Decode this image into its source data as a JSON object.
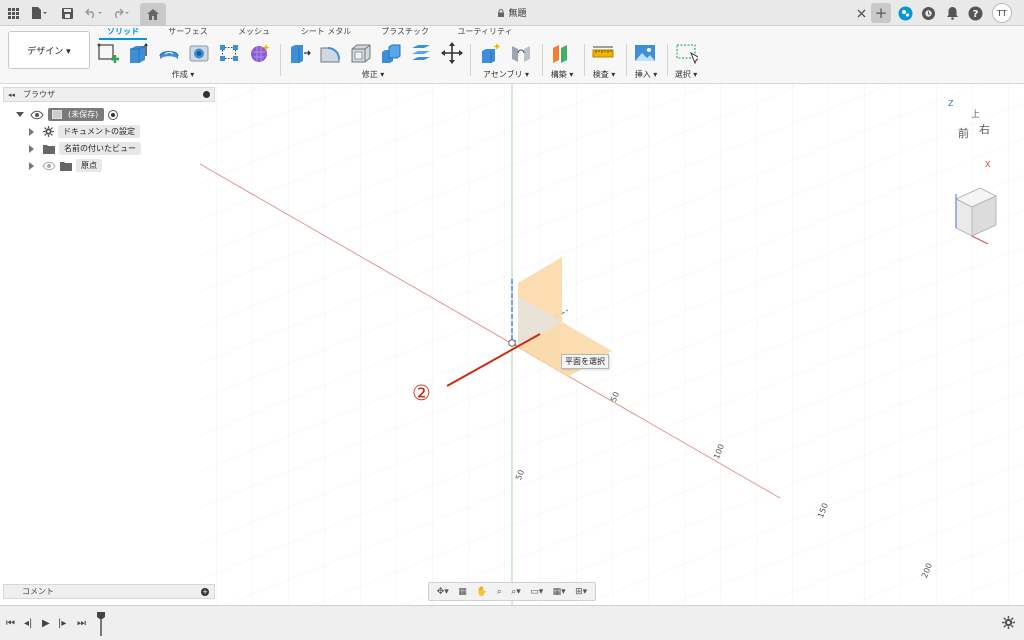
{
  "titlebar": {
    "document_title": "無題",
    "avatar_initials": "TT"
  },
  "toolbar": {
    "workspace_label": "デザイン ▾",
    "tabs": [
      {
        "label": "ソリッド",
        "active": true
      },
      {
        "label": "サーフェス",
        "active": false
      },
      {
        "label": "メッシュ",
        "active": false
      },
      {
        "label": "シート メタル",
        "active": false
      },
      {
        "label": "プラスチック",
        "active": false
      },
      {
        "label": "ユーティリティ",
        "active": false
      }
    ],
    "groups": {
      "create": "作成 ▾",
      "modify": "修正 ▾",
      "assemble": "アセンブリ ▾",
      "construct": "構築 ▾",
      "inspect": "検査 ▾",
      "insert": "挿入 ▾",
      "select": "選択 ▾"
    }
  },
  "browser": {
    "title": "ブラウザ",
    "root": "(未保存)",
    "items": [
      {
        "label": "ドキュメントの設定"
      },
      {
        "label": "名前の付いたビュー"
      },
      {
        "label": "原点"
      }
    ]
  },
  "comments": {
    "title": "コメント"
  },
  "viewport": {
    "tooltip": "平面を選択",
    "annotation_marker": "②",
    "tick_labels": [
      "50",
      "100",
      "150",
      "200",
      "50"
    ],
    "viewcube": {
      "top": "上",
      "front": "前",
      "right": "右",
      "axis_z": "Z",
      "axis_x": "X"
    }
  },
  "colors": {
    "accent": "#0696d7",
    "plane_fill": "#fcd9a8",
    "x_axis": "#e58a8a",
    "y_axis": "#7ccf7c",
    "z_axis": "#5a8be0",
    "annotation": "#cc2a10"
  }
}
